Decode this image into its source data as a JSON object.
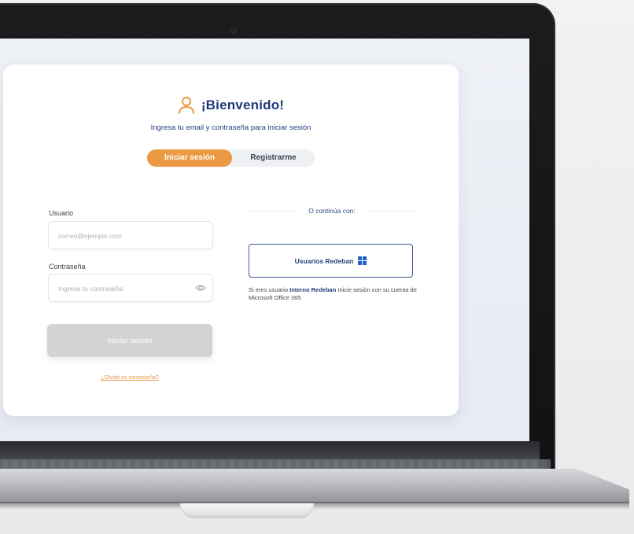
{
  "welcome": {
    "title": "¡Bienvenido!",
    "subtitle": "Ingresa tu email y contraseña para iniciar sesión",
    "icon": "user-icon"
  },
  "tabs": [
    {
      "label": "Iniciar sesión",
      "active": true
    },
    {
      "label": "Registrarme",
      "active": false
    }
  ],
  "form": {
    "user_label": "Usuario",
    "user_placeholder": "correo@ejemplo.com",
    "password_label": "Contraseña",
    "password_placeholder": "Ingresa tu contraseña",
    "password_icon": "eye-icon",
    "submit_label": "Iniciar sesión",
    "forgot_label": "¿Olvidé mi contraseña?"
  },
  "alt_login": {
    "divider_text": "O continúa con:",
    "button_label": "Usuarios Redeban",
    "button_icon": "windows-icon",
    "info_prefix": "Si eres usuario ",
    "info_highlight": "Interno Redeban",
    "info_suffix": " Inicie sesión con su cuenta de Microsoft Office 365"
  },
  "colors": {
    "primary": "#eb9a43",
    "title": "#1e3a78",
    "disabled_button": "#d3d3d3",
    "windows_blue": "#1f63c9"
  }
}
